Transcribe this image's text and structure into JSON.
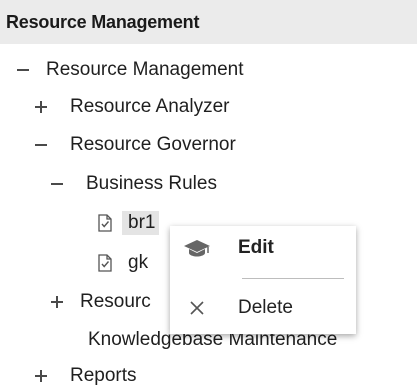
{
  "header": {
    "title": "Resource Management"
  },
  "tree": {
    "root": {
      "label": "Resource Management",
      "expanded": true
    },
    "resource_analyzer": {
      "label": "Resource Analyzer",
      "expanded": false
    },
    "resource_governor": {
      "label": "Resource Governor",
      "expanded": true
    },
    "business_rules": {
      "label": "Business Rules",
      "expanded": true
    },
    "br1": {
      "label": "br1",
      "selected": true
    },
    "gk": {
      "label": "gk"
    },
    "resource_partial": {
      "label": "Resourc",
      "expanded": false
    },
    "kb_maintenance": {
      "label": "Knowledgebase Maintenance"
    },
    "reports": {
      "label": "Reports",
      "expanded": false
    }
  },
  "context_menu": {
    "items": [
      {
        "label": "Edit",
        "icon": "graduation-cap-icon"
      },
      {
        "label": "Delete",
        "icon": "close-icon"
      }
    ]
  },
  "colors": {
    "header_bg": "#ebebeb",
    "selection_bg": "#e4e4e4",
    "text": "#1f1f1f"
  }
}
